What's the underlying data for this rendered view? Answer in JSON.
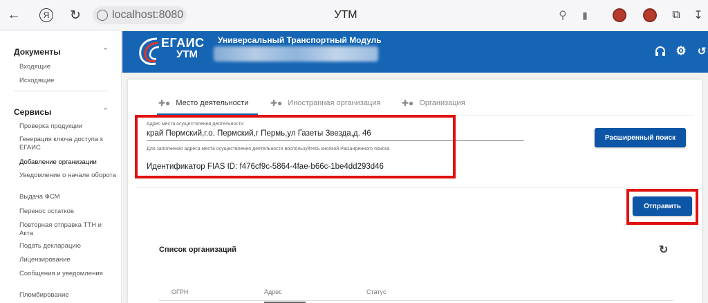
{
  "browser": {
    "url": "localhost:8080",
    "page_title": "УТМ",
    "icons": [
      "back-arrow-icon",
      "yandex-logo-icon",
      "reload-icon",
      "site-info-icon",
      "search-icon",
      "bookmark-icon",
      "extension-icon",
      "extension-icon",
      "collections-icon",
      "download-icon"
    ]
  },
  "sidebar": {
    "sections": [
      {
        "title": "Документы",
        "items": [
          "Входящие",
          "Исходящие"
        ]
      },
      {
        "title": "Сервисы",
        "items": [
          "Проверка продукции",
          "Генерация ключа доступа к ЕГАИС",
          "Добавление организации",
          "Уведомление о начале оборота",
          "Выдача ФСМ",
          "Перенос остатков",
          "Повторная отправка ТТН и Акта",
          "Подать декларацию",
          "Лицензирование",
          "Сообщения и уведомления",
          "Пломбирование"
        ]
      }
    ],
    "active_item": "Добавление организации"
  },
  "header": {
    "logo_main": "ЕГАИС",
    "logo_sub": "УТМ",
    "title": "Универсальный Транспортный Модуль",
    "icons": [
      "headset-icon",
      "gear-icon",
      "history-icon"
    ],
    "accent_color": "#1565b4"
  },
  "tabs": [
    {
      "label": "Место деятельности",
      "active": true
    },
    {
      "label": "Иностранная организация",
      "active": false
    },
    {
      "label": "Организация",
      "active": false
    }
  ],
  "form": {
    "address_label": "Адрес места осуществления деятельности",
    "address_value": "край Пермский,г.о. Пермский,г Пермь,ул Газеты Звезда,д. 46",
    "address_hint": "Для заполнения адреса места осуществления деятельности воспользуйтесь кнопкой Расширенного поиска",
    "fias": "Идентификатор FIAS ID: f476cf9c-5864-4fae-b66c-1be4dd293d46",
    "search_button": "Расширенный поиск",
    "send_button": "Отправить"
  },
  "list": {
    "title": "Список организаций",
    "columns": [
      "ОГРН",
      "Адрес",
      "Статус"
    ]
  },
  "highlight_color": "#e01010"
}
